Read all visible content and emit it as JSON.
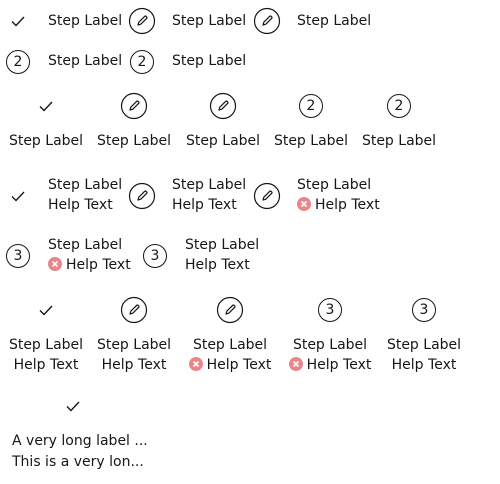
{
  "step_label": "Step Label",
  "help_text": "Help Text",
  "step2": "2",
  "step3": "3",
  "long_label": "A very long label ...",
  "long_help": "This is a very lon...",
  "icons": {
    "complete": "checkmark-icon",
    "current": "pencil-icon",
    "error": "error-icon"
  }
}
